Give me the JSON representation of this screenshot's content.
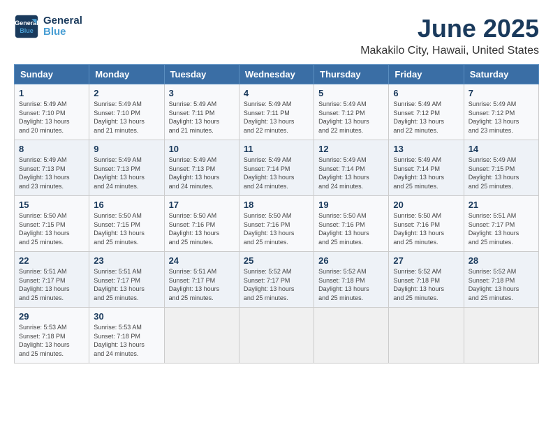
{
  "logo": {
    "line1": "General",
    "line2": "Blue"
  },
  "title": "June 2025",
  "subtitle": "Makakilo City, Hawaii, United States",
  "weekdays": [
    "Sunday",
    "Monday",
    "Tuesday",
    "Wednesday",
    "Thursday",
    "Friday",
    "Saturday"
  ],
  "weeks": [
    [
      {
        "day": "1",
        "info": "Sunrise: 5:49 AM\nSunset: 7:10 PM\nDaylight: 13 hours\nand 20 minutes."
      },
      {
        "day": "2",
        "info": "Sunrise: 5:49 AM\nSunset: 7:10 PM\nDaylight: 13 hours\nand 21 minutes."
      },
      {
        "day": "3",
        "info": "Sunrise: 5:49 AM\nSunset: 7:11 PM\nDaylight: 13 hours\nand 21 minutes."
      },
      {
        "day": "4",
        "info": "Sunrise: 5:49 AM\nSunset: 7:11 PM\nDaylight: 13 hours\nand 22 minutes."
      },
      {
        "day": "5",
        "info": "Sunrise: 5:49 AM\nSunset: 7:12 PM\nDaylight: 13 hours\nand 22 minutes."
      },
      {
        "day": "6",
        "info": "Sunrise: 5:49 AM\nSunset: 7:12 PM\nDaylight: 13 hours\nand 22 minutes."
      },
      {
        "day": "7",
        "info": "Sunrise: 5:49 AM\nSunset: 7:12 PM\nDaylight: 13 hours\nand 23 minutes."
      }
    ],
    [
      {
        "day": "8",
        "info": "Sunrise: 5:49 AM\nSunset: 7:13 PM\nDaylight: 13 hours\nand 23 minutes."
      },
      {
        "day": "9",
        "info": "Sunrise: 5:49 AM\nSunset: 7:13 PM\nDaylight: 13 hours\nand 24 minutes."
      },
      {
        "day": "10",
        "info": "Sunrise: 5:49 AM\nSunset: 7:13 PM\nDaylight: 13 hours\nand 24 minutes."
      },
      {
        "day": "11",
        "info": "Sunrise: 5:49 AM\nSunset: 7:14 PM\nDaylight: 13 hours\nand 24 minutes."
      },
      {
        "day": "12",
        "info": "Sunrise: 5:49 AM\nSunset: 7:14 PM\nDaylight: 13 hours\nand 24 minutes."
      },
      {
        "day": "13",
        "info": "Sunrise: 5:49 AM\nSunset: 7:14 PM\nDaylight: 13 hours\nand 25 minutes."
      },
      {
        "day": "14",
        "info": "Sunrise: 5:49 AM\nSunset: 7:15 PM\nDaylight: 13 hours\nand 25 minutes."
      }
    ],
    [
      {
        "day": "15",
        "info": "Sunrise: 5:50 AM\nSunset: 7:15 PM\nDaylight: 13 hours\nand 25 minutes."
      },
      {
        "day": "16",
        "info": "Sunrise: 5:50 AM\nSunset: 7:15 PM\nDaylight: 13 hours\nand 25 minutes."
      },
      {
        "day": "17",
        "info": "Sunrise: 5:50 AM\nSunset: 7:16 PM\nDaylight: 13 hours\nand 25 minutes."
      },
      {
        "day": "18",
        "info": "Sunrise: 5:50 AM\nSunset: 7:16 PM\nDaylight: 13 hours\nand 25 minutes."
      },
      {
        "day": "19",
        "info": "Sunrise: 5:50 AM\nSunset: 7:16 PM\nDaylight: 13 hours\nand 25 minutes."
      },
      {
        "day": "20",
        "info": "Sunrise: 5:50 AM\nSunset: 7:16 PM\nDaylight: 13 hours\nand 25 minutes."
      },
      {
        "day": "21",
        "info": "Sunrise: 5:51 AM\nSunset: 7:17 PM\nDaylight: 13 hours\nand 25 minutes."
      }
    ],
    [
      {
        "day": "22",
        "info": "Sunrise: 5:51 AM\nSunset: 7:17 PM\nDaylight: 13 hours\nand 25 minutes."
      },
      {
        "day": "23",
        "info": "Sunrise: 5:51 AM\nSunset: 7:17 PM\nDaylight: 13 hours\nand 25 minutes."
      },
      {
        "day": "24",
        "info": "Sunrise: 5:51 AM\nSunset: 7:17 PM\nDaylight: 13 hours\nand 25 minutes."
      },
      {
        "day": "25",
        "info": "Sunrise: 5:52 AM\nSunset: 7:17 PM\nDaylight: 13 hours\nand 25 minutes."
      },
      {
        "day": "26",
        "info": "Sunrise: 5:52 AM\nSunset: 7:18 PM\nDaylight: 13 hours\nand 25 minutes."
      },
      {
        "day": "27",
        "info": "Sunrise: 5:52 AM\nSunset: 7:18 PM\nDaylight: 13 hours\nand 25 minutes."
      },
      {
        "day": "28",
        "info": "Sunrise: 5:52 AM\nSunset: 7:18 PM\nDaylight: 13 hours\nand 25 minutes."
      }
    ],
    [
      {
        "day": "29",
        "info": "Sunrise: 5:53 AM\nSunset: 7:18 PM\nDaylight: 13 hours\nand 25 minutes."
      },
      {
        "day": "30",
        "info": "Sunrise: 5:53 AM\nSunset: 7:18 PM\nDaylight: 13 hours\nand 24 minutes."
      },
      {
        "day": "",
        "info": ""
      },
      {
        "day": "",
        "info": ""
      },
      {
        "day": "",
        "info": ""
      },
      {
        "day": "",
        "info": ""
      },
      {
        "day": "",
        "info": ""
      }
    ]
  ]
}
